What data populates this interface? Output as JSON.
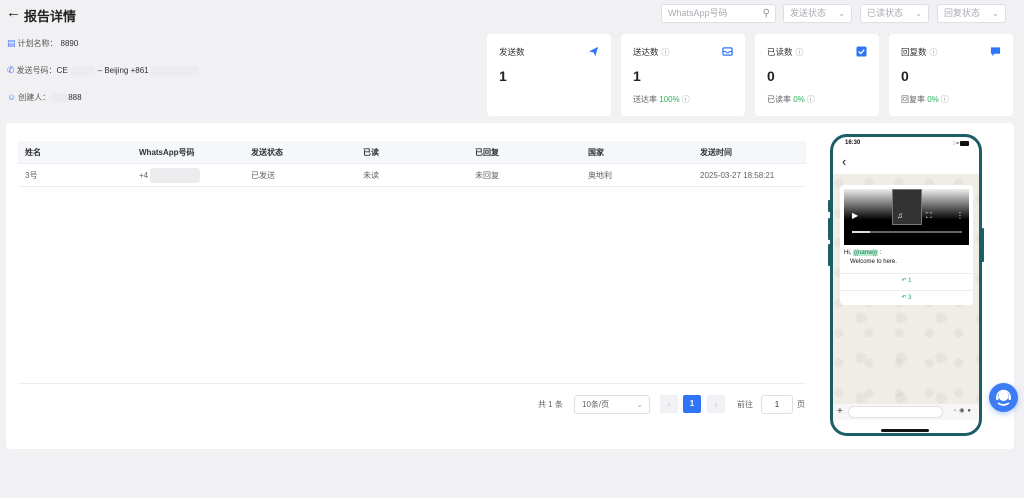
{
  "header": {
    "title": "报告详情",
    "filters": {
      "whatsapp_placeholder": "WhatsApp号码",
      "send_status_placeholder": "发送状态",
      "read_status_placeholder": "已读状态",
      "reply_status_placeholder": "回复状态"
    }
  },
  "info": {
    "plan_name_label": "计划名称：",
    "plan_name_value": "8890",
    "sender_label": "发送号码：",
    "sender_prefix": "CE",
    "sender_value": "– Beijing +861",
    "creator_label": "创建人：",
    "creator_value": "888"
  },
  "stats": [
    {
      "label": "发送数",
      "value": "1",
      "icon": "paper-plane-icon"
    },
    {
      "label": "送达数",
      "value": "1",
      "sub_label": "送达率",
      "sub_value": "100%",
      "icon": "inbox-icon"
    },
    {
      "label": "已读数",
      "value": "0",
      "sub_label": "已读率",
      "sub_value": "0%",
      "icon": "checkbox-icon"
    },
    {
      "label": "回复数",
      "value": "0",
      "sub_label": "回复率",
      "sub_value": "0%",
      "icon": "chat-bubble-icon"
    }
  ],
  "table": {
    "columns": [
      "姓名",
      "WhatsApp号码",
      "发送状态",
      "已读",
      "已回复",
      "国家",
      "发送时间"
    ],
    "rows": [
      {
        "name": "3号",
        "phone": "+4",
        "send_status": "已发送",
        "read": "未读",
        "replied": "未回复",
        "country": "奥地利",
        "time": "2025-03-27 18:58:21"
      }
    ]
  },
  "pagination": {
    "total": "共 1 条",
    "page_size": "10条/页",
    "current": "1",
    "goto_label": "前往",
    "goto_value": "1",
    "page_suffix": "页"
  },
  "preview": {
    "time": "16:30",
    "greeting": "Hi,",
    "variable": "{{name}}",
    "greeting_end": ":",
    "body": "Welcome to here.",
    "quick_replies": [
      "1",
      "3"
    ]
  },
  "colors": {
    "primary": "#2f76f6",
    "success": "#2bb35b",
    "phone_frame": "#1c5e66"
  }
}
